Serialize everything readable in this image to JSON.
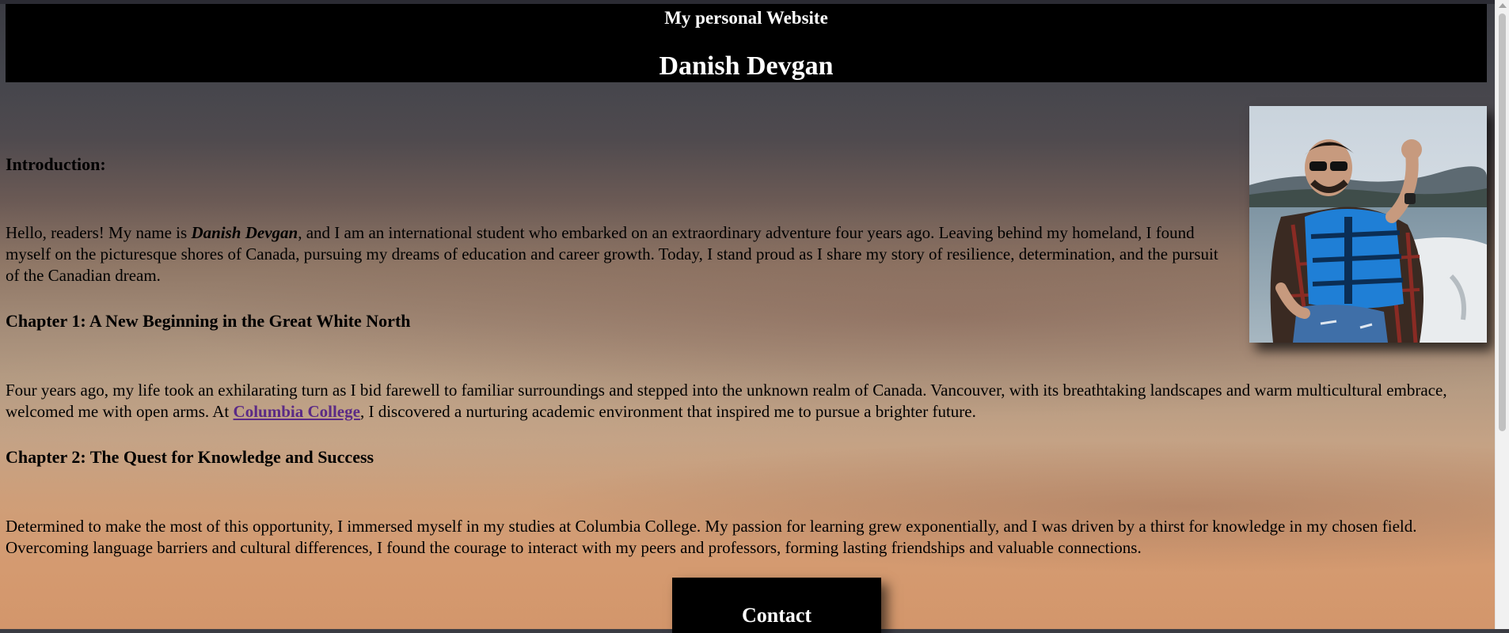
{
  "header": {
    "site_title": "My personal Website",
    "name": "Danish Devgan"
  },
  "photo": {
    "icon": "profile-photo"
  },
  "intro": {
    "heading": "Introduction:",
    "text_before": "Hello, readers! My name is ",
    "name_emphasis": "Danish Devgan",
    "text_after": ", and I am an international student who embarked on an extraordinary adventure four years ago. Leaving behind my homeland, I found myself on the picturesque shores of Canada, pursuing my dreams of education and career growth. Today, I stand proud as I share my story of resilience, determination, and the pursuit of the Canadian dream."
  },
  "chapter1": {
    "heading": "Chapter 1: A New Beginning in the Great White North",
    "text_before": "Four years ago, my life took an exhilarating turn as I bid farewell to familiar surroundings and stepped into the unknown realm of Canada. Vancouver, with its breathtaking landscapes and warm multicultural embrace, welcomed me with open arms. At ",
    "link_label": "Columbia College",
    "text_after": ", I discovered a nurturing academic environment that inspired me to pursue a brighter future."
  },
  "chapter2": {
    "heading": "Chapter 2: The Quest for Knowledge and Success",
    "text": "Determined to make the most of this opportunity, I immersed myself in my studies at Columbia College. My passion for learning grew exponentially, and I was driven by a thirst for knowledge in my chosen field. Overcoming language barriers and cultural differences, I found the courage to interact with my peers and professors, forming lasting friendships and valuable connections."
  },
  "contact": {
    "label": "Contact"
  },
  "colors": {
    "header_bg": "#000000",
    "link": "#5b2a86"
  }
}
